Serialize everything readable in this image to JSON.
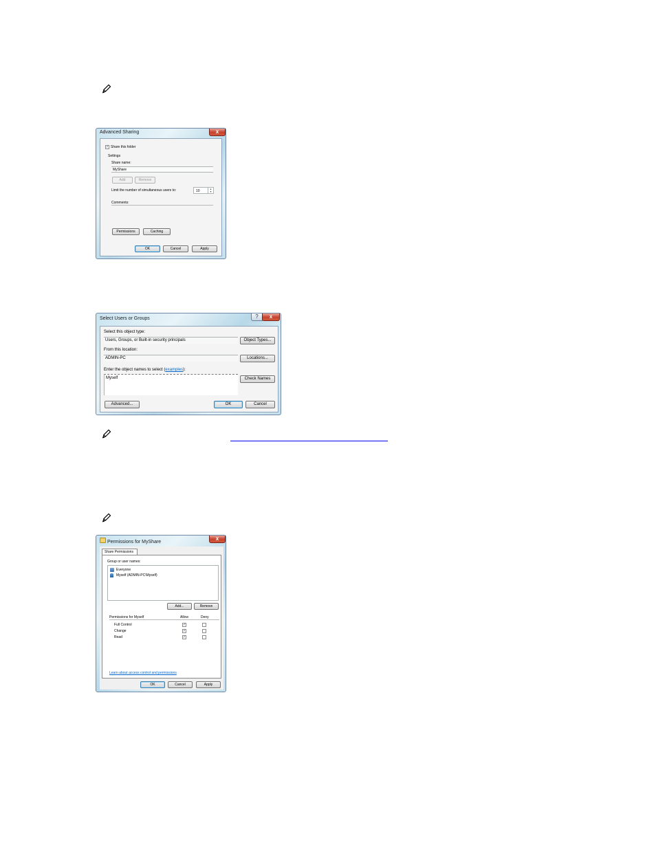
{
  "notes": {
    "link_text": "",
    "icons": [
      "pencil-note-icon",
      "pencil-note-icon",
      "pencil-note-icon"
    ]
  },
  "advanced_sharing": {
    "title": "Advanced Sharing",
    "close": "x",
    "share_checkbox_label": "Share this folder",
    "share_checked": "✓",
    "settings_label": "Settings",
    "share_name_label": "Share name:",
    "share_name_value": "MyShare",
    "add_label": "Add",
    "remove_label": "Remove",
    "limit_label": "Limit the number of simultaneous users to:",
    "limit_value": "10",
    "comments_label": "Comments:",
    "permissions_label": "Permissions",
    "caching_label": "Caching",
    "ok_label": "OK",
    "cancel_label": "Cancel",
    "apply_label": "Apply"
  },
  "select_users": {
    "title": "Select Users or Groups",
    "help": "?",
    "close": "x",
    "object_type_label": "Select this object type:",
    "object_type_value": "Users, Groups, or Built-in security principals",
    "object_types_button": "Object Types...",
    "location_label": "From this location:",
    "location_value": "ADMIN-PC",
    "locations_button": "Locations...",
    "enter_names_label": "Enter the object names to select (",
    "examples_link": "examples",
    "enter_names_suffix": "):",
    "names_value": "Myself",
    "check_names_button": "Check Names",
    "advanced_button": "Advanced...",
    "ok_label": "OK",
    "cancel_label": "Cancel"
  },
  "permissions": {
    "title": "Permissions for MyShare",
    "close": "x",
    "tab_label": "Share Permissions",
    "group_label": "Group or user names:",
    "users": [
      {
        "name": "Everyone",
        "icon": "group-icon"
      },
      {
        "name": "Myself (ADMIN-PC\\Myself)",
        "icon": "user-icon"
      }
    ],
    "add_label": "Add...",
    "remove_label": "Remove",
    "permissions_for_label": "Permissions for Myself",
    "allow_label": "Allow",
    "deny_label": "Deny",
    "rows": [
      {
        "name": "Full Control",
        "allow": "✓",
        "deny": ""
      },
      {
        "name": "Change",
        "allow": "✓",
        "deny": ""
      },
      {
        "name": "Read",
        "allow": "✓",
        "deny": ""
      }
    ],
    "learn_link": "Learn about access control and permissions",
    "ok_label": "OK",
    "cancel_label": "Cancel",
    "apply_label": "Apply"
  }
}
